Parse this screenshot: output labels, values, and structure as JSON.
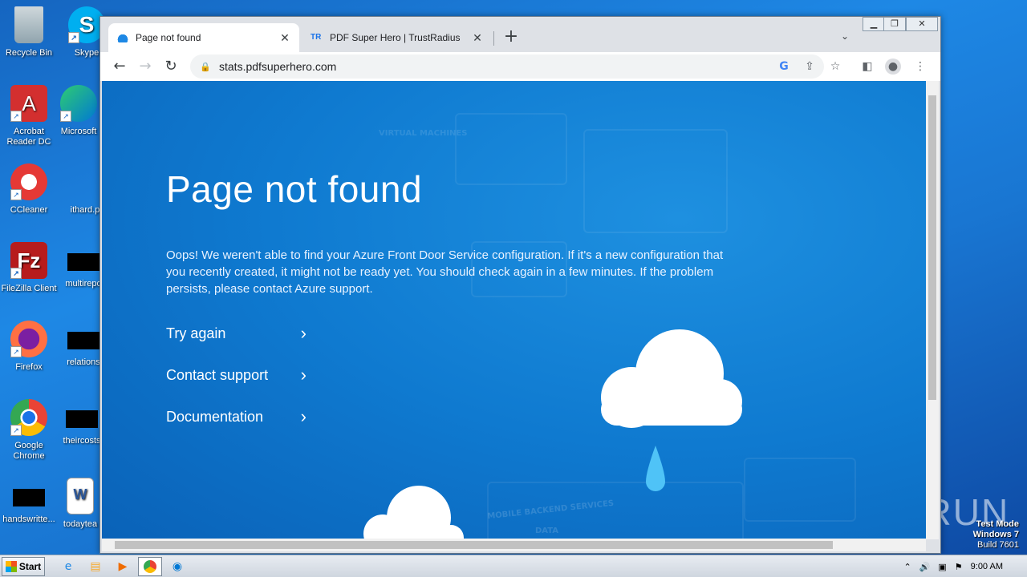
{
  "desktop": {
    "icons": [
      {
        "label": "Recycle Bin"
      },
      {
        "label": "Skype"
      },
      {
        "label": "Acrobat Reader DC"
      },
      {
        "label": "Microsoft"
      },
      {
        "label": "CCleaner"
      },
      {
        "label": "ithard.p"
      },
      {
        "label": "FileZilla Client"
      },
      {
        "label": "multirepo"
      },
      {
        "label": "Firefox"
      },
      {
        "label": "relations"
      },
      {
        "label": "Google Chrome"
      },
      {
        "label": "theircosts"
      },
      {
        "label": "handswritte..."
      },
      {
        "label": "todaytea"
      }
    ]
  },
  "browser": {
    "tabs": [
      {
        "title": "Page not found",
        "active": true
      },
      {
        "title": "PDF Super Hero | TrustRadius",
        "active": false
      }
    ],
    "new_tab": "+",
    "url": "stats.pdfsuperhero.com"
  },
  "page": {
    "heading": "Page not found",
    "message": "Oops! We weren't able to find your Azure Front Door Service configuration. If it's a new configuration that you recently created, it might not be ready yet. You should check again in a few minutes. If the problem persists, please contact Azure support.",
    "links": [
      {
        "label": "Try again"
      },
      {
        "label": "Contact support"
      },
      {
        "label": "Documentation"
      }
    ],
    "bg_labels": [
      "VIRTUAL MACHINES",
      "MOBILE BACKEND SERVICES",
      "DATA"
    ]
  },
  "taskbar": {
    "start_label": "Start",
    "time": "9:00 AM"
  },
  "watermark": {
    "line1": "Test Mode",
    "line2": "Windows 7",
    "line3": "Build 7601",
    "brand": "ANY RUN"
  },
  "colors": {
    "page_bg": "#0f7ad0",
    "accent": "#1a73e8"
  }
}
